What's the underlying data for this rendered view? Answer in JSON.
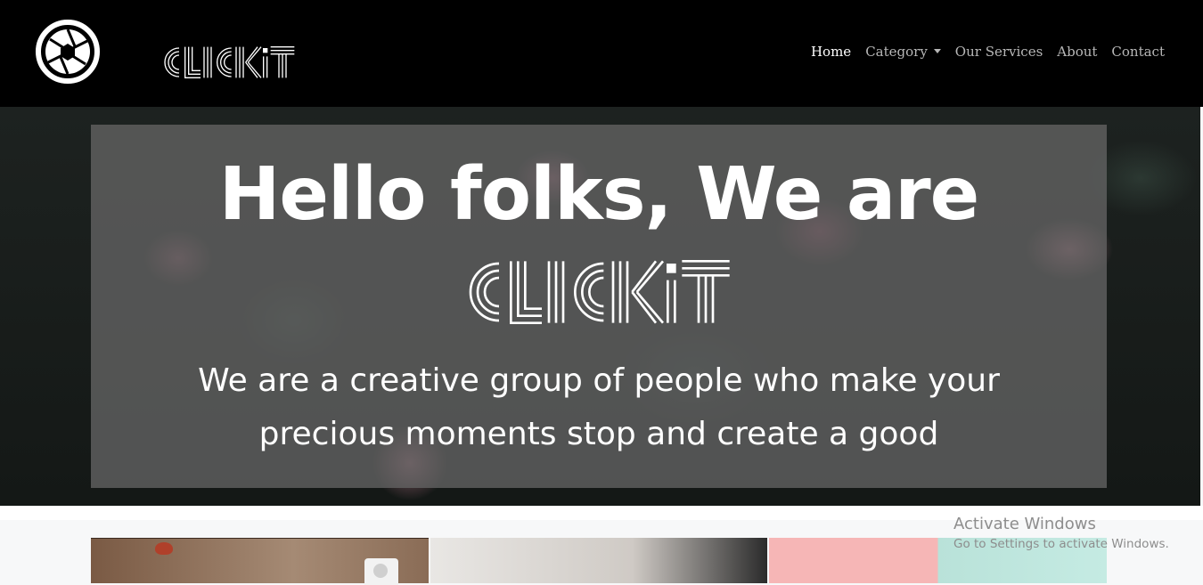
{
  "brand": {
    "name": "CLICKit"
  },
  "nav": {
    "items": [
      {
        "label": "Home",
        "active": true
      },
      {
        "label": "Category",
        "dropdown": true
      },
      {
        "label": "Our Services"
      },
      {
        "label": "About"
      },
      {
        "label": "Contact"
      }
    ]
  },
  "hero": {
    "title": "Hello folks, We are",
    "brand_word": "CLICKit",
    "subtitle": "We are a creative group of people who make your precious moments stop and create a good"
  },
  "watermark": {
    "title": "Activate Windows",
    "subtitle": "Go to Settings to activate Windows."
  },
  "colors": {
    "navbar": "#000000",
    "overlay": "#646464",
    "text": "#ffffff"
  }
}
